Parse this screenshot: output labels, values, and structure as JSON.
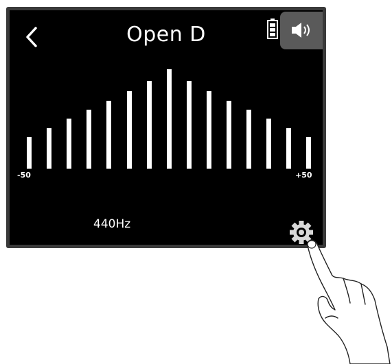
{
  "header": {
    "back_icon": "chevron-left-icon",
    "title": "Open D",
    "battery_icon": "battery-icon",
    "speaker_icon": "speaker-icon"
  },
  "meter": {
    "scale_min_label": "-50",
    "scale_max_label": "+50",
    "bar_levels": [
      0.32,
      0.41,
      0.5,
      0.59,
      0.68,
      0.78,
      0.88,
      1.0,
      0.88,
      0.78,
      0.68,
      0.59,
      0.5,
      0.41,
      0.32
    ]
  },
  "footer": {
    "reference_frequency": "440Hz",
    "settings_icon": "gear-icon"
  },
  "overlay": {
    "hand_icon": "pointing-hand-icon"
  },
  "colors": {
    "screen_bg": "#000000",
    "bezel": "#3a3a3a",
    "speaker_button_bg": "#5a5a5a",
    "foreground": "#ffffff"
  }
}
